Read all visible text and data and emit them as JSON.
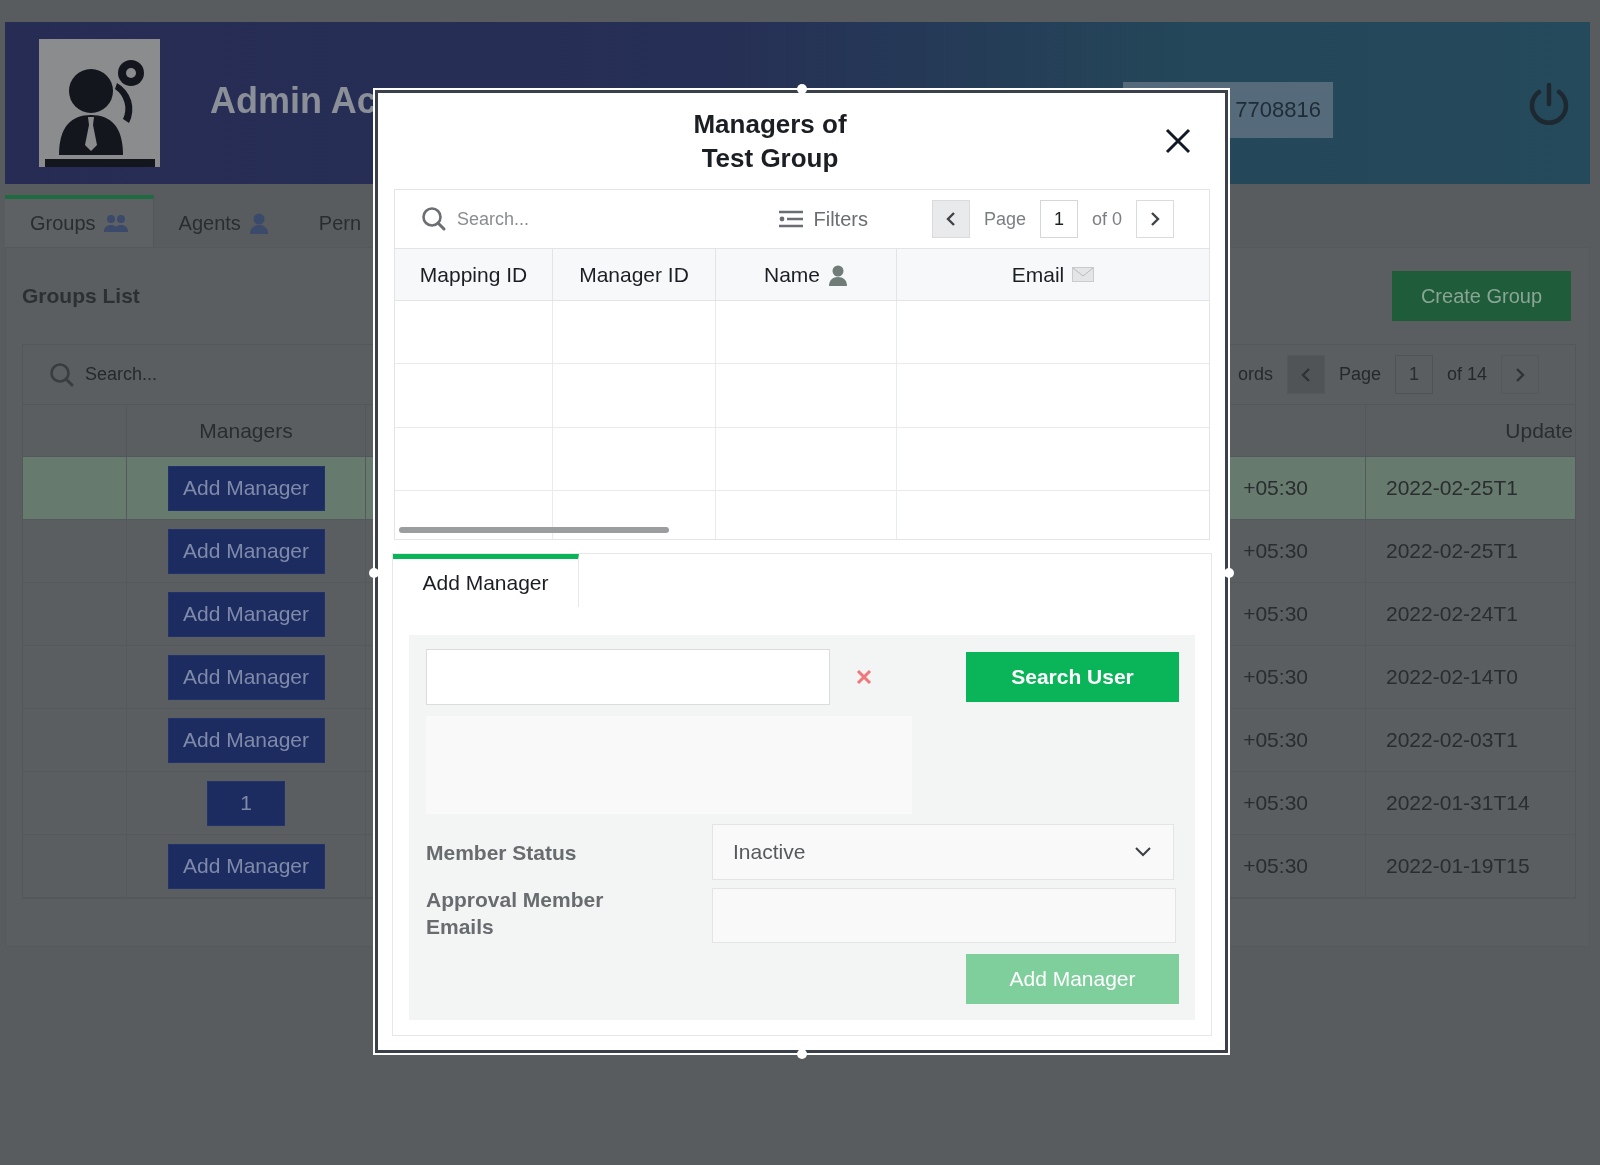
{
  "header": {
    "title": "Admin Ac",
    "user_id": "7708816"
  },
  "tabs": [
    {
      "label": "Groups",
      "selected": true
    },
    {
      "label": "Agents",
      "selected": false
    },
    {
      "label": "Pern",
      "selected": false
    }
  ],
  "groups_list": {
    "heading": "Groups List",
    "create_button": "Create Group",
    "search": {
      "placeholder": "Search..."
    },
    "pager": {
      "records_label": "ords",
      "page_label": "Page",
      "page": "1",
      "of": "of 14"
    },
    "columns": [
      "Managers",
      "Update"
    ],
    "rows": [
      {
        "selected": true,
        "managers": "Add Manager",
        "column_3": "+05:30",
        "updated": "2022-02-25T1"
      },
      {
        "selected": false,
        "managers": "Add Manager",
        "column_3": "+05:30",
        "updated": "2022-02-25T1"
      },
      {
        "selected": false,
        "managers": "Add Manager",
        "column_3": "+05:30",
        "updated": "2022-02-24T1"
      },
      {
        "selected": false,
        "managers": "Add Manager",
        "column_3": "+05:30",
        "updated": "2022-02-14T0"
      },
      {
        "selected": false,
        "managers": "Add Manager",
        "column_3": "+05:30",
        "updated": "2022-02-03T1"
      },
      {
        "selected": false,
        "managers": "1",
        "column_3": "+05:30",
        "updated": "2022-01-31T14"
      },
      {
        "selected": false,
        "managers": "Add Manager",
        "column_3": "+05:30",
        "updated": "2022-01-19T15"
      }
    ]
  },
  "modal": {
    "title": "Managers of Test Group",
    "table": {
      "search": {
        "placeholder": "Search..."
      },
      "filters_label": "Filters",
      "pager": {
        "page_label": "Page",
        "page": "1",
        "of": "of 0"
      },
      "columns": [
        "Mapping ID",
        "Manager ID",
        "Name",
        "Email"
      ]
    },
    "add_manager": {
      "tabs": [
        {
          "label": "Add Manager",
          "selected": true
        }
      ],
      "search_button": "Search User",
      "status": {
        "label": "Member Status",
        "value": "Inactive"
      },
      "approval": {
        "label": "Approval Member Emails"
      },
      "submit": {
        "label": "Add Manager",
        "disabled": true
      }
    }
  }
}
